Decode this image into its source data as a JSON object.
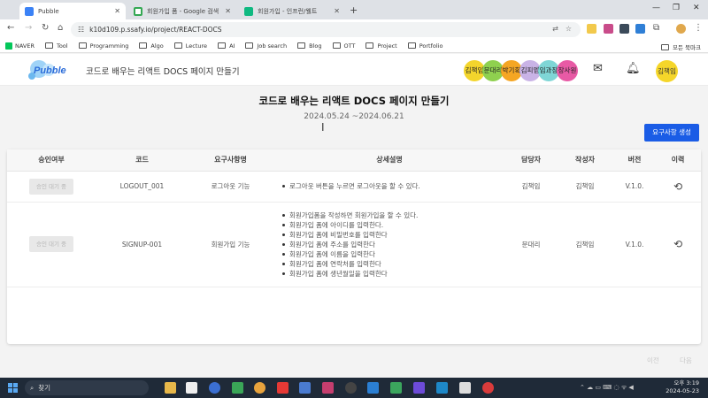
{
  "browser": {
    "tabs": [
      {
        "label": "Pubble",
        "fav_color": "#3b82f6"
      },
      {
        "label": "회원가입 폼 - Google 검색",
        "fav_color": "#34a853"
      },
      {
        "label": "회원가입 - 인프런/웰트",
        "fav_color": "#0fb981"
      }
    ],
    "new_tab": "+",
    "url": "k10d109.p.ssafy.io/project/REACT-DOCS",
    "bookmarks": [
      "NAVER",
      "Tool",
      "Programming",
      "Algo",
      "Lecture",
      "AI",
      "Job search",
      "Blog",
      "OTT",
      "Project",
      "Portfolio"
    ],
    "all_bookmarks": "모든 북마크"
  },
  "header": {
    "logo_text": "Pubble",
    "project_name": "코드로 배우는 리액트 DOCS 페이지 만들기",
    "members": [
      {
        "name": "김책임",
        "color": "#f3d52c"
      },
      {
        "name": "문대리",
        "color": "#8fd14f"
      },
      {
        "name": "박기획",
        "color": "#f5a623"
      },
      {
        "name": "김피엠",
        "color": "#c9b3e6"
      },
      {
        "name": "임과장",
        "color": "#7fd6d6"
      },
      {
        "name": "장사원",
        "color": "#e85aa5"
      }
    ],
    "user": "김책임"
  },
  "main": {
    "title": "코드로 배우는 리액트 DOCS 페이지 만들기",
    "period": "2024.05.24 ~2024.06.21",
    "create_button": "요구사항 생성",
    "columns": [
      "승인여부",
      "코드",
      "요구사항명",
      "상세설명",
      "담당자",
      "작성자",
      "버전",
      "이력"
    ],
    "rows": [
      {
        "approval": "승인 대기 중",
        "code": "LOGOUT_001",
        "name": "로그아웃 기능",
        "details": [
          "로그아웃 버튼을 누르면 로그아웃을 할 수 있다."
        ],
        "assignee": "김책임",
        "author": "김책임",
        "version": "V.1.0."
      },
      {
        "approval": "승인 대기 중",
        "code": "SIGNUP-001",
        "name": "회원가입 기능",
        "details": [
          "회원가입폼을 작성하면 회원가입을 할 수 있다.",
          "회원가입 폼에 아이디를 입력한다.",
          "회원가입 폼에 비밀번호를 입력한다",
          "회원가입 폼에 주소를 입력한다",
          "회원가입 폼에 이름을 입력한다",
          "회원가입 폼에 연락처를 입력한다",
          "회원가입 폼에 생년월일을 입력한다"
        ],
        "assignee": "문대리",
        "author": "김책임",
        "version": "V.1.0."
      }
    ],
    "prev": "이전",
    "next": "다음"
  },
  "taskbar": {
    "search_placeholder": "찾기",
    "time": "오후 3:19",
    "date": "2024-05-23"
  }
}
